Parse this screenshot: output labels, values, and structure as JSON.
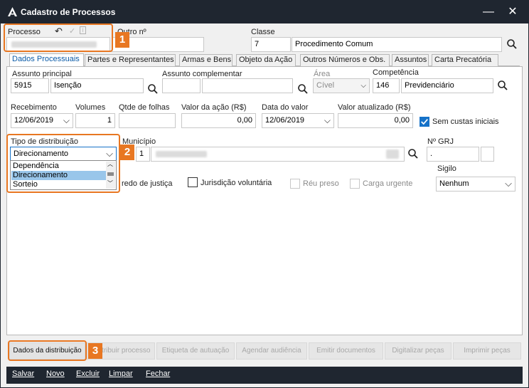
{
  "window": {
    "title": "Cadastro de Processos",
    "minimize": "—",
    "close": "✕"
  },
  "header": {
    "processo_label": "Processo",
    "outro_label": "Outro nº",
    "classe_label": "Classe",
    "classe_code": "7",
    "classe_name": "Procedimento Comum"
  },
  "tabs": [
    {
      "label": "Dados Processuais"
    },
    {
      "label": "Partes e Representantes"
    },
    {
      "label": "Armas e Bens"
    },
    {
      "label": "Objeto da Ação"
    },
    {
      "label": "Outros Números e Obs."
    },
    {
      "label": "Assuntos"
    },
    {
      "label": "Carta Precatória"
    }
  ],
  "form": {
    "assunto_principal_label": "Assunto principal",
    "assunto_code": "5915",
    "assunto_name": "Isenção",
    "assunto_complementar_label": "Assunto complementar",
    "area_label": "Área",
    "area_value": "Cível",
    "competencia_label": "Competência",
    "competencia_code": "146",
    "competencia_name": "Previdenciário",
    "recebimento_label": "Recebimento",
    "recebimento_value": "12/06/2019",
    "volumes_label": "Volumes",
    "volumes_value": "1",
    "folhas_label": "Qtde de folhas",
    "valor_acao_label": "Valor da ação (R$)",
    "valor_acao_value": "0,00",
    "data_valor_label": "Data do valor",
    "data_valor_value": "12/06/2019",
    "valor_atualizado_label": "Valor atualizado (R$)",
    "valor_atualizado_value": "0,00",
    "sem_custas_label": "Sem custas iniciais",
    "tipo_dist_label": "Tipo de distribuição",
    "tipo_dist_value": "Direcionamento",
    "tipo_dist_options": [
      "Dependência",
      "Direcionamento",
      "Sorteio"
    ],
    "municipio_label": "Município",
    "municipio_code": "1",
    "grj_label": "Nº GRJ",
    "grj_value": ".",
    "sigilo_label": "Sigilo",
    "sigilo_value": "Nenhum",
    "segredo_label": "redo de justiça",
    "jurisdicao_label": "Jurisdição voluntária",
    "reu_preso_label": "Réu preso",
    "carga_urgente_label": "Carga urgente"
  },
  "actions": [
    {
      "label": "Dados da distribuição"
    },
    {
      "label": "Distribuir processo"
    },
    {
      "label": "Etiqueta de autuação"
    },
    {
      "label": "Agendar audiência"
    },
    {
      "label": "Emitir documentos"
    },
    {
      "label": "Digitalizar peças"
    },
    {
      "label": "Imprimir peças"
    }
  ],
  "bottom": [
    {
      "label": "Salvar"
    },
    {
      "label": "Novo"
    },
    {
      "label": "Excluir"
    },
    {
      "label": "Limpar"
    },
    {
      "label": "Fechar"
    }
  ],
  "callouts": [
    "1",
    "2",
    "3"
  ],
  "colors": {
    "titlebar": "#1f2630",
    "accent": "#e87722",
    "link": "#0b5ba8",
    "selection": "#99c6ea",
    "check": "#1672c8"
  },
  "icons": [
    "app-logo-icon",
    "undo-icon",
    "check-icon",
    "info-icon",
    "search-icon",
    "chevron-down-icon"
  ]
}
